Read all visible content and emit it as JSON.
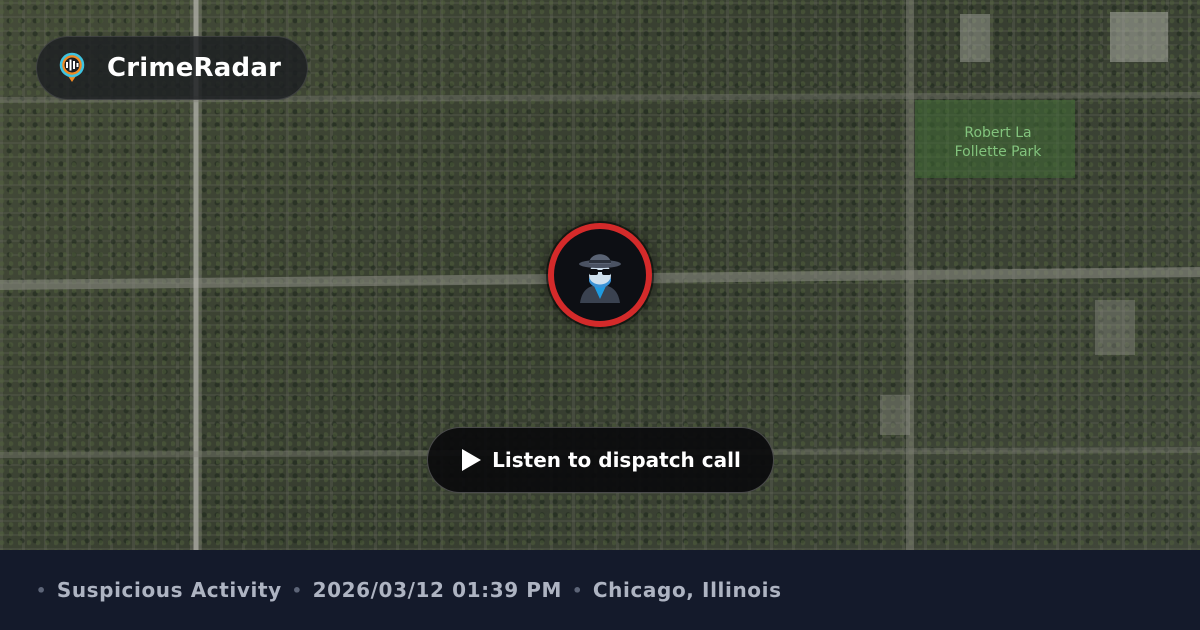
{
  "brand": {
    "name": "CrimeRadar",
    "icon": "radar-pin-icon"
  },
  "map": {
    "park_label_line1": "Robert La",
    "park_label_line2": "Follette Park",
    "marker_icon": "incognito-agent-icon",
    "marker_color": "#d42a2a"
  },
  "player": {
    "label": "Listen to dispatch call",
    "icon": "play-icon"
  },
  "incident": {
    "category": "Suspicious Activity",
    "datetime": "2026/03/12 01:39 PM",
    "location": "Chicago, Illinois",
    "separator": "•"
  }
}
